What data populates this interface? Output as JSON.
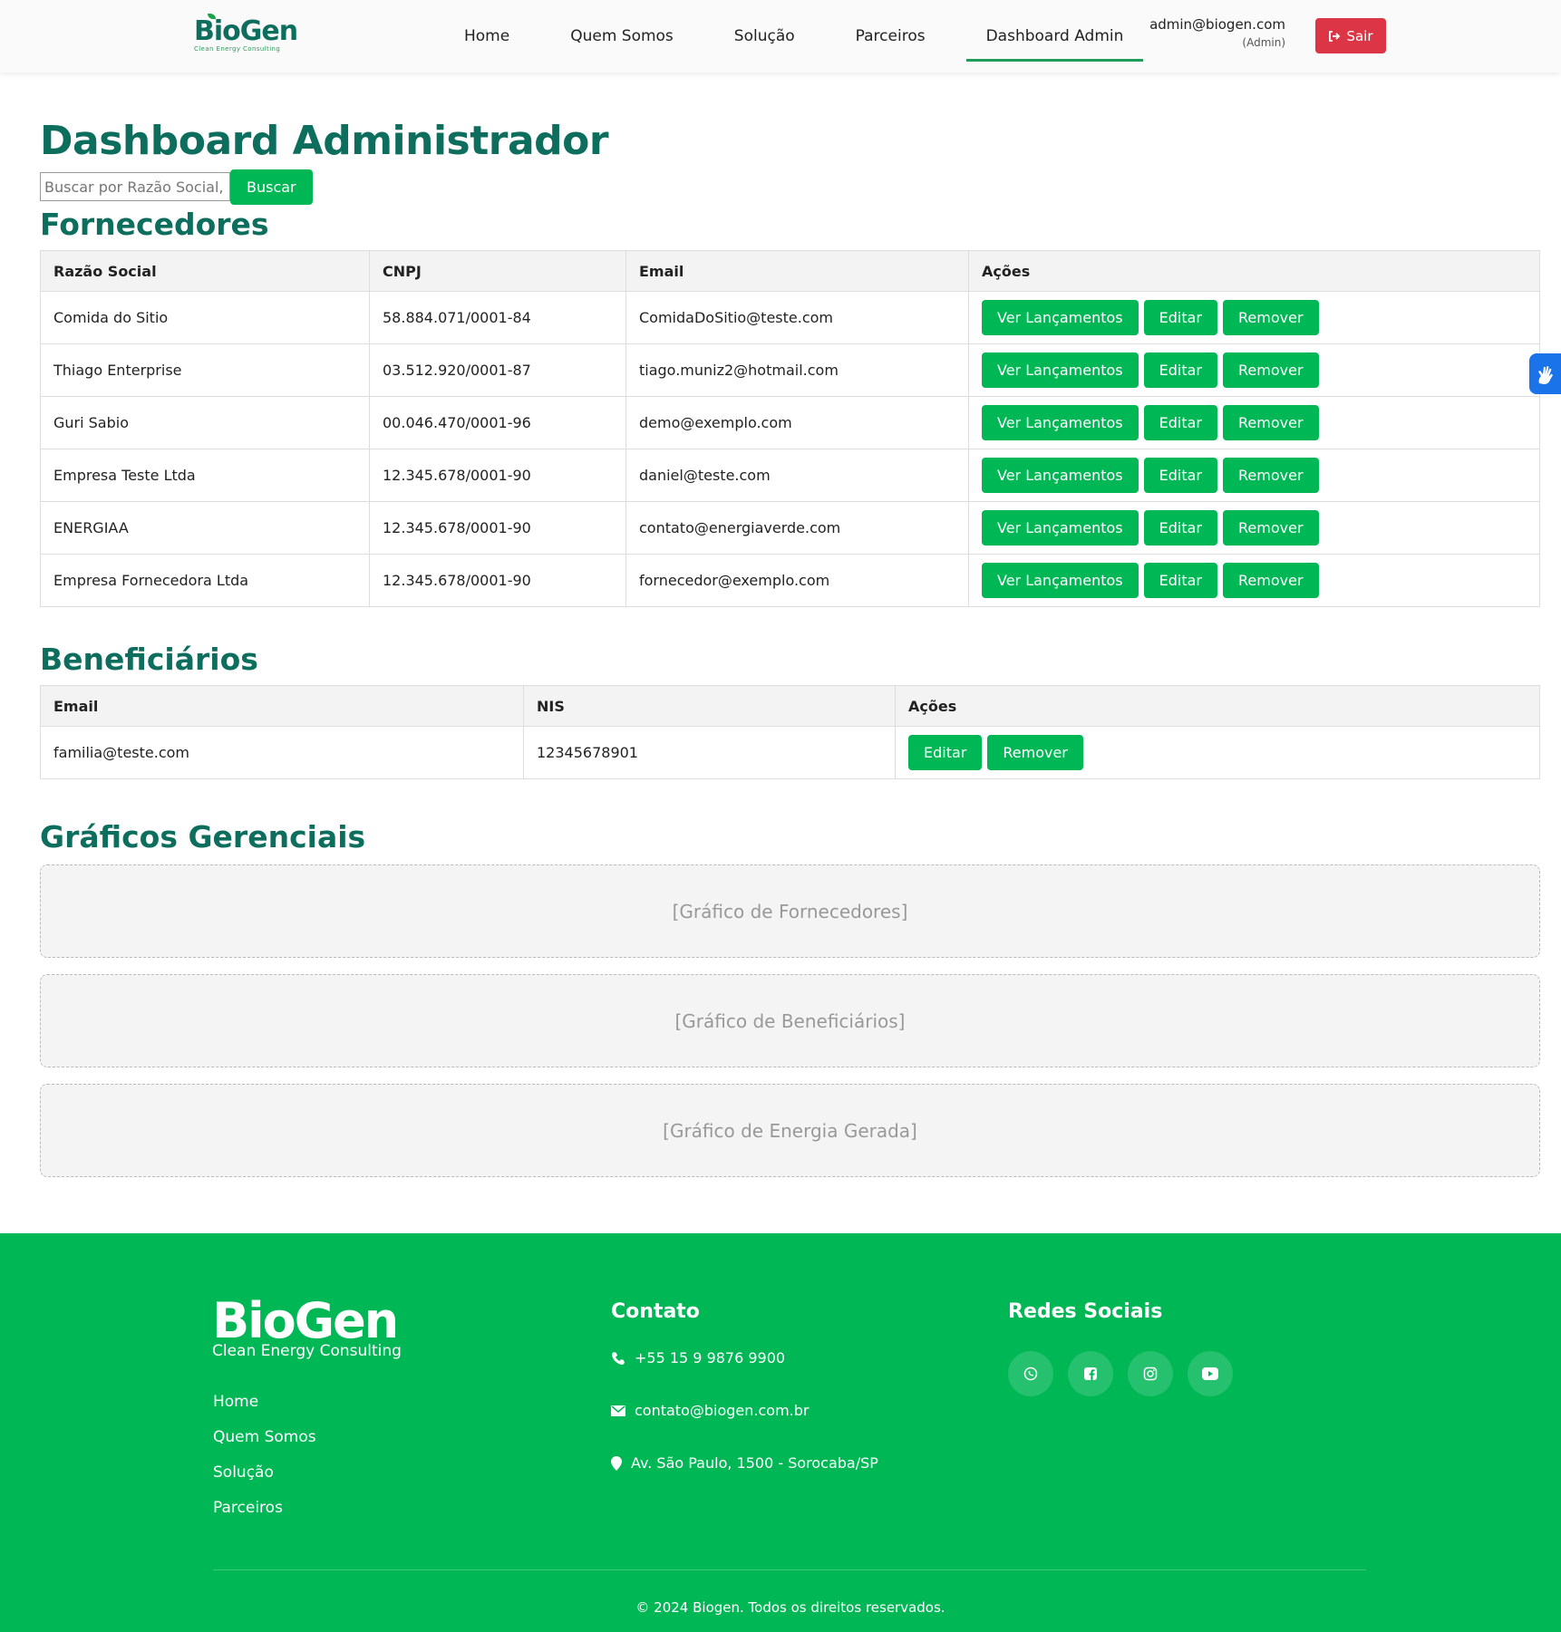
{
  "header": {
    "logo_word": "BioGen",
    "logo_tagline": "Clean Energy Consulting",
    "nav": [
      "Home",
      "Quem Somos",
      "Solução",
      "Parceiros",
      "Dashboard Admin"
    ],
    "active_nav": "Dashboard Admin",
    "user_email": "admin@biogen.com",
    "user_role": "(Admin)",
    "logout_label": "Sair"
  },
  "page_title": "Dashboard Administrador",
  "search": {
    "placeholder": "Buscar por Razão Social, C",
    "button_label": "Buscar"
  },
  "fornecedores": {
    "title": "Fornecedores",
    "headers": [
      "Razão Social",
      "CNPJ",
      "Email",
      "Ações"
    ],
    "rows": [
      {
        "razao": "Comida do Sitio",
        "cnpj": "58.884.071/0001-84",
        "email": "ComidaDoSitio@teste.com"
      },
      {
        "razao": "Thiago Enterprise",
        "cnpj": "03.512.920/0001-87",
        "email": "tiago.muniz2@hotmail.com"
      },
      {
        "razao": "Guri Sabio",
        "cnpj": "00.046.470/0001-96",
        "email": "demo@exemplo.com"
      },
      {
        "razao": "Empresa Teste Ltda",
        "cnpj": "12.345.678/0001-90",
        "email": "daniel@teste.com"
      },
      {
        "razao": "ENERGIAA",
        "cnpj": "12.345.678/0001-90",
        "email": "contato@energiaverde.com"
      },
      {
        "razao": "Empresa Fornecedora Ltda",
        "cnpj": "12.345.678/0001-90",
        "email": "fornecedor@exemplo.com"
      }
    ],
    "actions": [
      "Ver Lançamentos",
      "Editar",
      "Remover"
    ]
  },
  "beneficiarios": {
    "title": "Beneficiários",
    "headers": [
      "Email",
      "NIS",
      "Ações"
    ],
    "rows": [
      {
        "email": "familia@teste.com",
        "nis": "12345678901"
      }
    ],
    "actions": [
      "Editar",
      "Remover"
    ]
  },
  "graficos": {
    "title": "Gráficos Gerenciais",
    "placeholders": [
      "[Gráfico de Fornecedores]",
      "[Gráfico de Beneficiários]",
      "[Gráfico de Energia Gerada]"
    ]
  },
  "footer": {
    "logo_word": "BioGen",
    "logo_tagline": "Clean Energy Consulting",
    "links": [
      "Home",
      "Quem Somos",
      "Solução",
      "Parceiros"
    ],
    "contact_title": "Contato",
    "phone": "+55 15 9 9876 9900",
    "email": "contato@biogen.com.br",
    "address": "Av. São Paulo, 1500 - Sorocaba/SP",
    "social_title": "Redes Sociais",
    "social_icons": [
      "whatsapp-icon",
      "facebook-icon",
      "instagram-icon",
      "youtube-icon"
    ],
    "copyright": "© 2024 Biogen. Todos os direitos reservados."
  },
  "colors": {
    "brand_dark": "#0d6e5e",
    "brand_green": "#00b755",
    "danger": "#dc3545"
  }
}
